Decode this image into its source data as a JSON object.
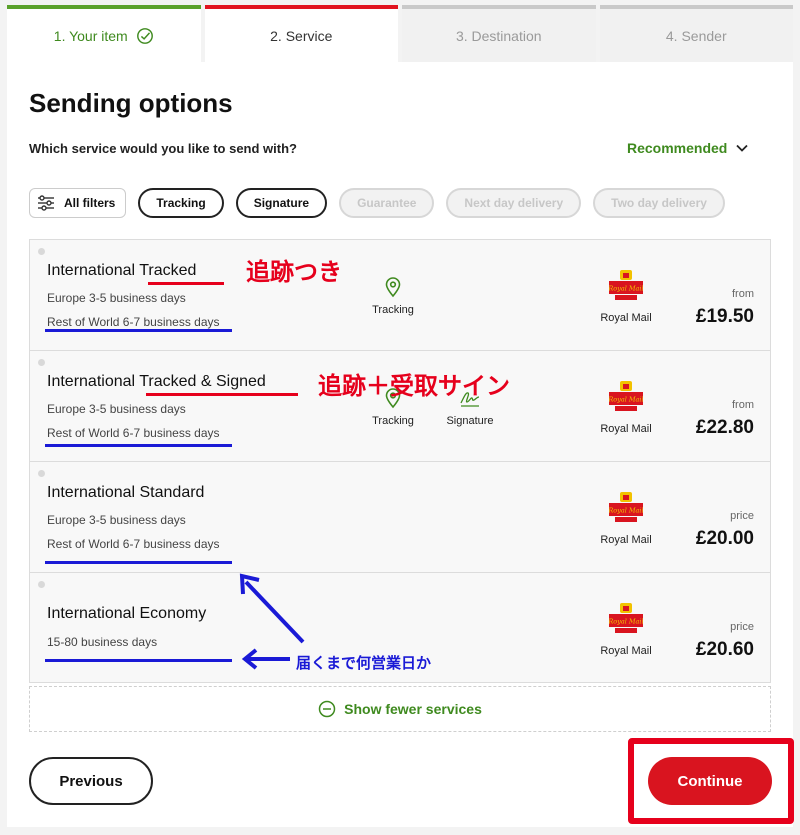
{
  "steps": [
    {
      "label": "1. Your item",
      "state": "done"
    },
    {
      "label": "2. Service",
      "state": "active"
    },
    {
      "label": "3. Destination",
      "state": "pending"
    },
    {
      "label": "4. Sender",
      "state": "pending"
    }
  ],
  "page": {
    "title": "Sending options",
    "question": "Which service would you like to send with?",
    "sort_label": "Recommended"
  },
  "filters": {
    "all_label": "All filters",
    "chips": [
      "Tracking",
      "Signature",
      "Guarantee",
      "Next day delivery",
      "Two day delivery"
    ]
  },
  "services": [
    {
      "name": "International Tracked",
      "line1": "Europe 3-5 business days",
      "line2": "Rest of World 6-7 business days",
      "features": [
        "Tracking"
      ],
      "carrier": "Royal Mail",
      "price_label": "from",
      "price": "£19.50"
    },
    {
      "name": "International Tracked & Signed",
      "line1": "Europe 3-5 business days",
      "line2": "Rest of World 6-7 business days",
      "features": [
        "Tracking",
        "Signature"
      ],
      "carrier": "Royal Mail",
      "price_label": "from",
      "price": "£22.80"
    },
    {
      "name": "International Standard",
      "line1": "Europe 3-5 business days",
      "line2": "Rest of World 6-7 business days",
      "features": [],
      "carrier": "Royal Mail",
      "price_label": "price",
      "price": "£20.00"
    },
    {
      "name": "International Economy",
      "line1": "15-80 business days",
      "line2": "",
      "features": [],
      "carrier": "Royal Mail",
      "price_label": "price",
      "price": "£20.60"
    }
  ],
  "logo_text": "Royal Mail",
  "show_fewer_label": "Show fewer services",
  "buttons": {
    "previous": "Previous",
    "continue": "Continue"
  },
  "annotations": {
    "tracked": "追跡つき",
    "tracked_signed": "追跡＋受取サイン",
    "business_days": "届くまで何営業日か"
  },
  "colors": {
    "brand_red": "#d9141f",
    "green": "#3f8a1f",
    "annotation_red": "#e6001c",
    "annotation_blue": "#1a1ad6"
  }
}
